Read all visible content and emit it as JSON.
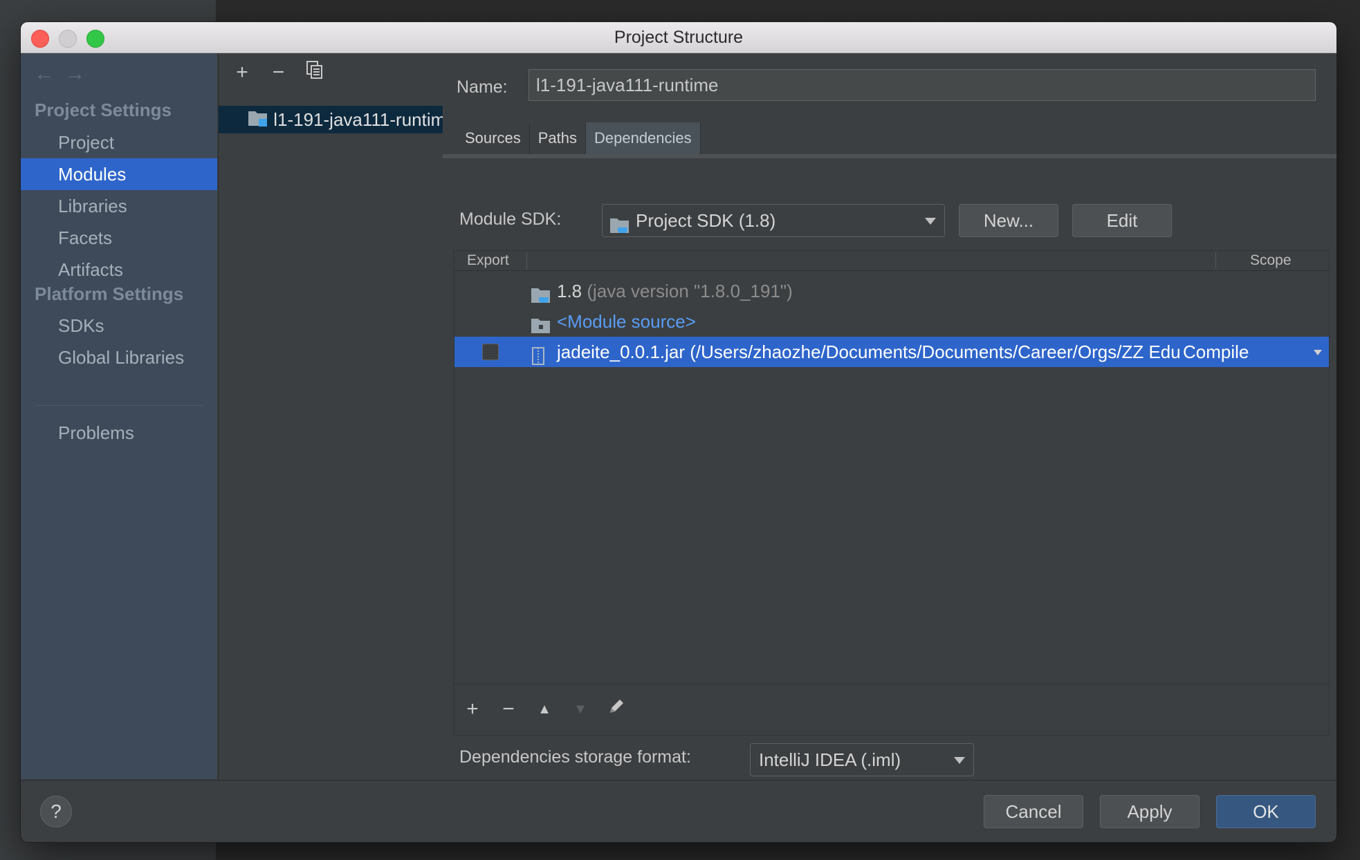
{
  "window": {
    "title": "Project Structure"
  },
  "nav": {
    "back_glyph": "←",
    "forward_glyph": "→",
    "project_settings_header": "Project Settings",
    "project_settings": [
      "Project",
      "Modules",
      "Libraries",
      "Facets",
      "Artifacts"
    ],
    "platform_settings_header": "Platform Settings",
    "platform_settings": [
      "SDKs",
      "Global Libraries"
    ],
    "problems": "Problems",
    "selected": "Modules"
  },
  "modules_toolbar": {
    "add": "+",
    "remove": "−",
    "copy_icon": "copy-icon"
  },
  "module_list": [
    {
      "name": "l1-191-java111-runtime"
    }
  ],
  "detail": {
    "name_label": "Name:",
    "name_value": "l1-191-java111-runtime",
    "tabs": [
      "Sources",
      "Paths",
      "Dependencies"
    ],
    "active_tab": "Dependencies",
    "module_sdk_label": "Module SDK:",
    "module_sdk_value": "Project SDK (1.8)",
    "new_button": "New...",
    "edit_button": "Edit",
    "table": {
      "col_export": "Export",
      "col_scope": "Scope",
      "rows": [
        {
          "name": "1.8",
          "detail": "(java version \"1.8.0_191\")",
          "type": "sdk"
        },
        {
          "name": "<Module source>",
          "type": "module-source"
        },
        {
          "name": "jadeite_0.0.1.jar (/Users/zhaozhe/Documents/Documents/Career/Orgs/ZZ Edu",
          "scope": "Compile",
          "exported": false,
          "selected": true,
          "type": "jar"
        }
      ]
    },
    "table_toolbar": {
      "add": "+",
      "remove": "−",
      "move_up": "▲",
      "move_down": "▼",
      "edit_icon": "pencil-icon"
    },
    "storage_format_label": "Dependencies storage format:",
    "storage_format_value": "IntelliJ IDEA (.iml)"
  },
  "footer": {
    "help": "?",
    "cancel": "Cancel",
    "apply": "Apply",
    "ok": "OK"
  },
  "colors": {
    "selection": "#2e65ca",
    "module_source_link": "#589df6",
    "ok_button": "#365880"
  }
}
